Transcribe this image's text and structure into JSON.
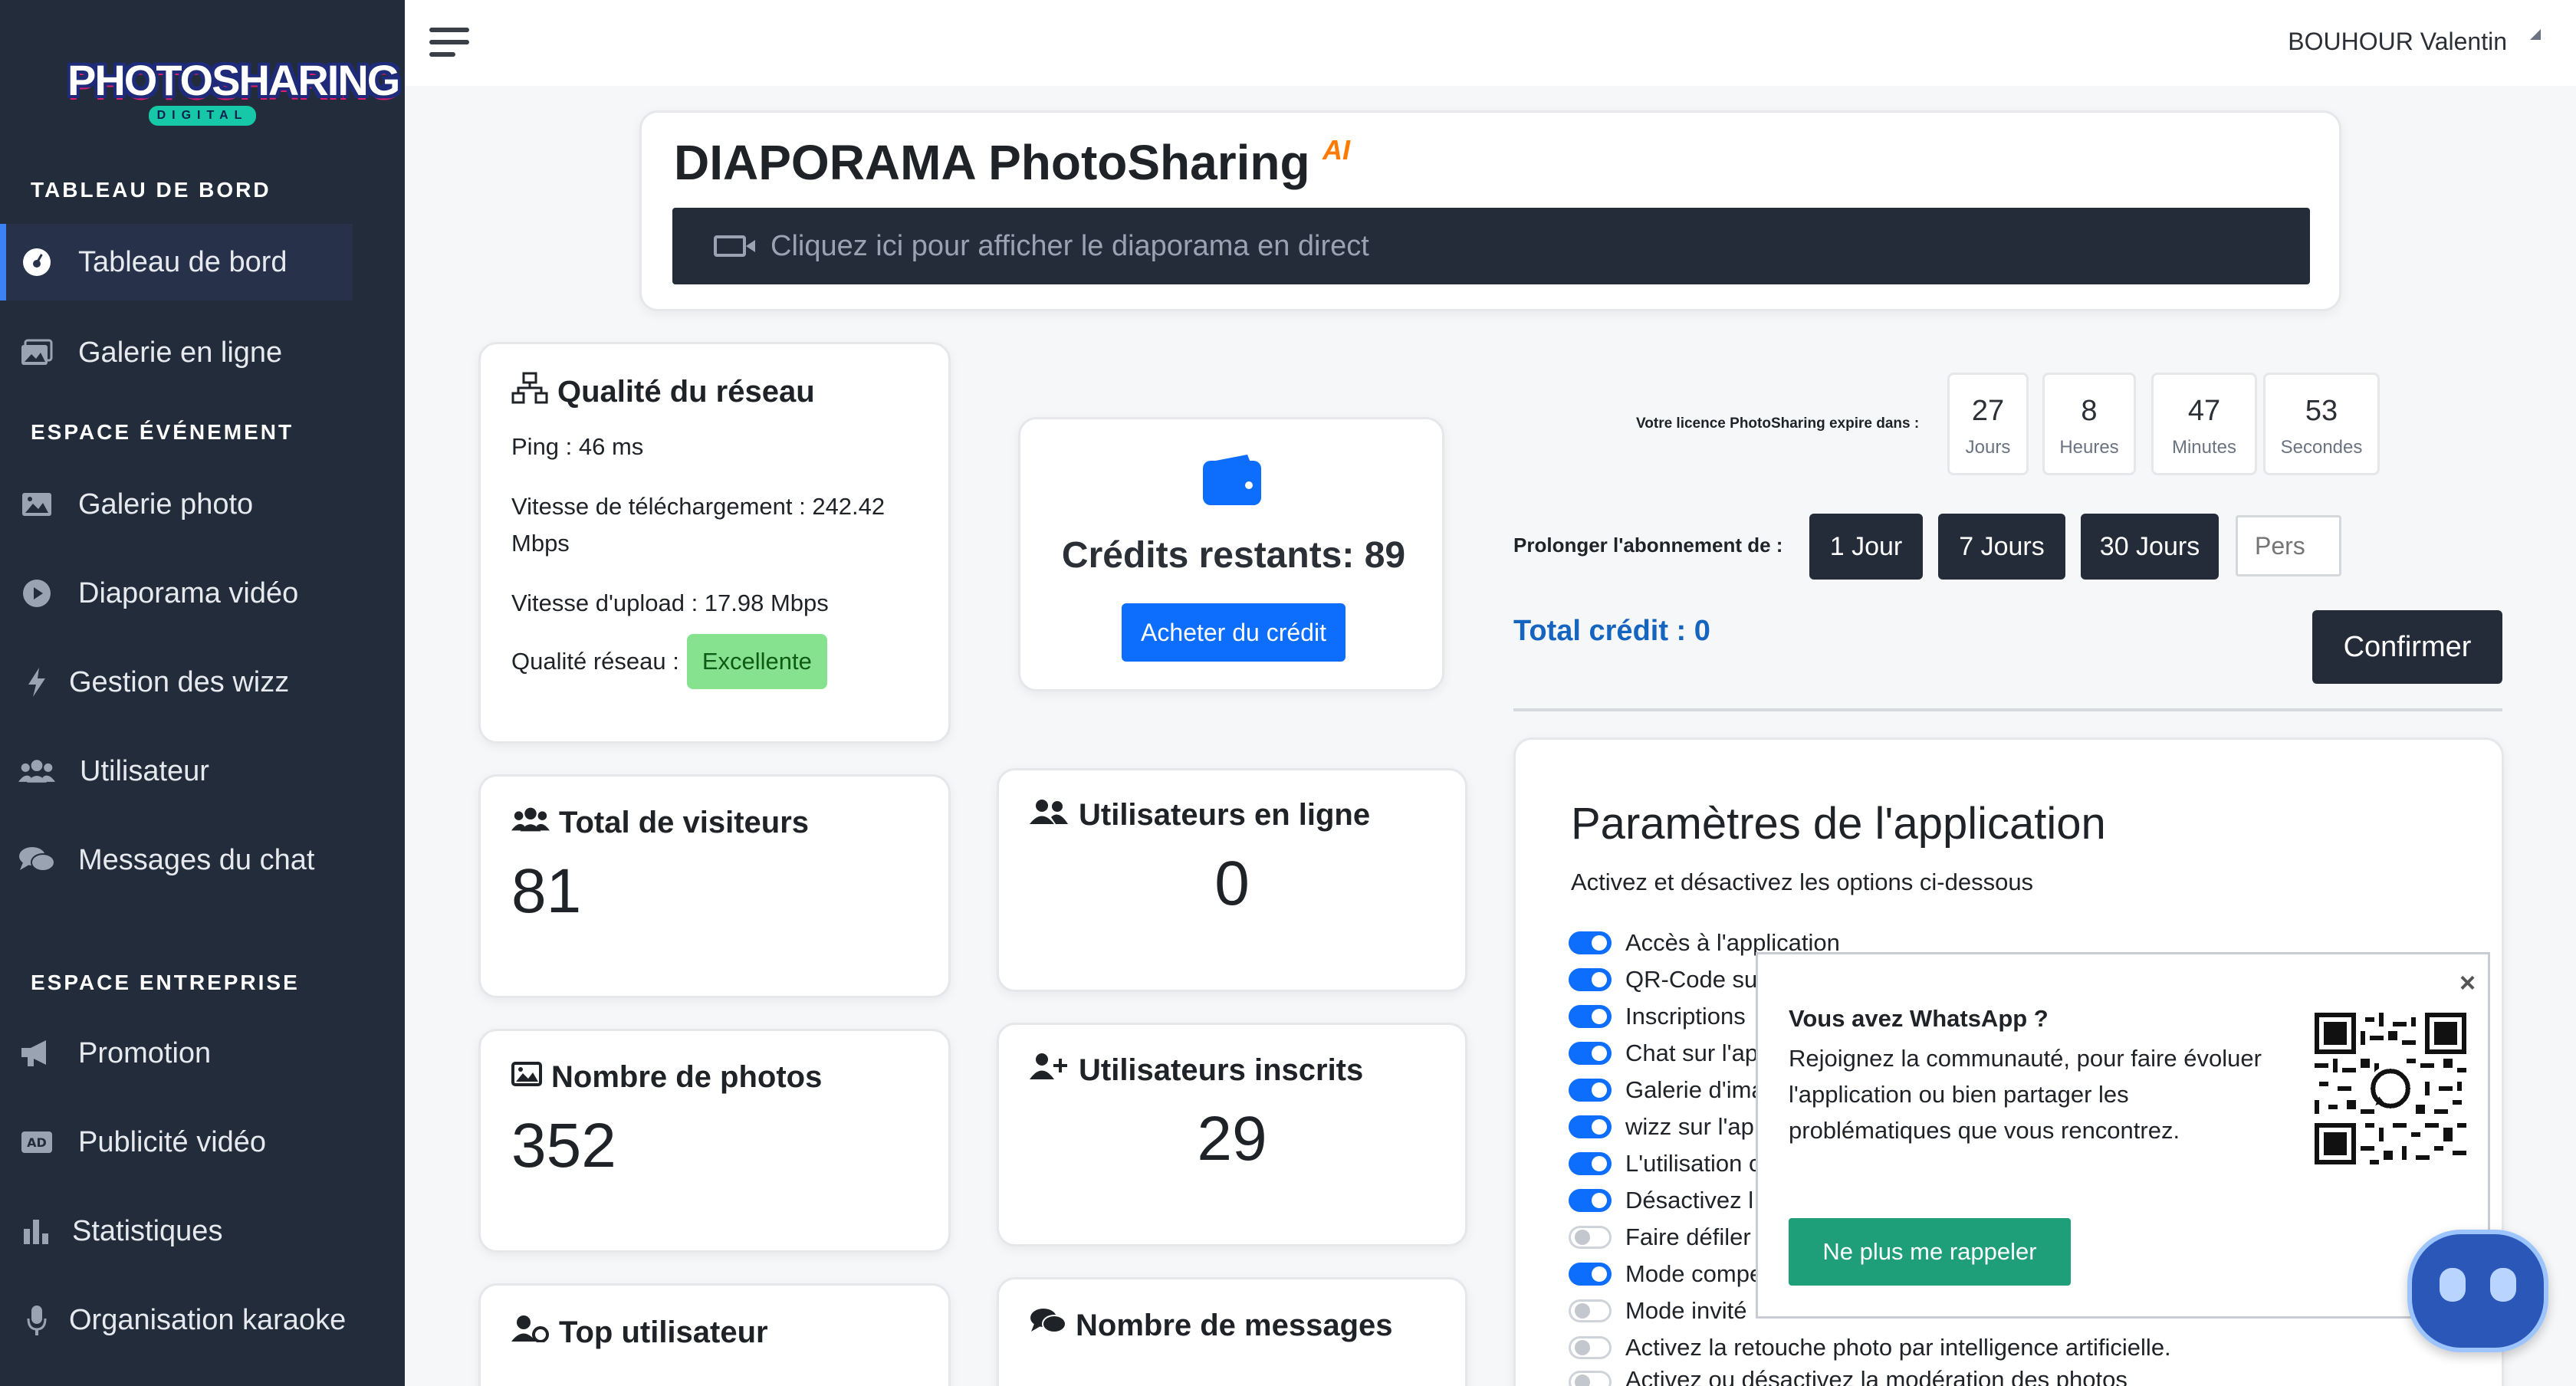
{
  "brand": {
    "name": "PHOTOSHARING",
    "sub": "DIGITAL"
  },
  "sidebar": {
    "sections": [
      {
        "title": "TABLEAU DE BORD"
      },
      {
        "title": "ESPACE ÉVÉNEMENT"
      },
      {
        "title": "ESPACE ENTREPRISE"
      }
    ],
    "items": [
      {
        "label": "Tableau de bord",
        "icon": "dashboard-icon",
        "active": true
      },
      {
        "label": "Galerie en ligne",
        "icon": "images-icon"
      },
      {
        "label": "Galerie photo",
        "icon": "image-icon"
      },
      {
        "label": "Diaporama vidéo",
        "icon": "play-icon"
      },
      {
        "label": "Gestion des wizz",
        "icon": "bolt-icon"
      },
      {
        "label": "Utilisateur",
        "icon": "users-icon"
      },
      {
        "label": "Messages du chat",
        "icon": "comments-icon"
      },
      {
        "label": "Promotion",
        "icon": "megaphone-icon"
      },
      {
        "label": "Publicité vidéo",
        "icon": "ad-icon"
      },
      {
        "label": "Statistiques",
        "icon": "chart-bar-icon"
      },
      {
        "label": "Organisation karaoke",
        "icon": "microphone-icon"
      }
    ]
  },
  "header": {
    "user": "BOUHOUR Valentin"
  },
  "diaporama": {
    "title": "DIAPORAMA PhotoSharing",
    "badge": "AI",
    "bar_text": "Cliquez ici pour afficher le diaporama en direct"
  },
  "network": {
    "title": "Qualité du réseau",
    "ping": "Ping : 46 ms",
    "download_line1": "Vitesse de téléchargement : 242.42",
    "download_line2": "Mbps",
    "upload": "Vitesse d'upload : 17.98 Mbps",
    "quality_label": "Qualité réseau :",
    "quality_value": "Excellente"
  },
  "credits": {
    "title": "Crédits restants: 89",
    "button": "Acheter du crédit"
  },
  "license": {
    "label": "Votre licence PhotoSharing expire dans :",
    "countdown": [
      {
        "value": "27",
        "unit": "Jours"
      },
      {
        "value": "8",
        "unit": "Heures"
      },
      {
        "value": "47",
        "unit": "Minutes"
      },
      {
        "value": "53",
        "unit": "Secondes"
      }
    ]
  },
  "extend": {
    "label": "Prolonger l'abonnement de :",
    "options": [
      "1 Jour",
      "7 Jours",
      "30 Jours"
    ],
    "custom_placeholder": "Pers",
    "total": "Total crédit : 0",
    "confirm": "Confirmer"
  },
  "stats": {
    "visitors": {
      "title": "Total de visiteurs",
      "value": "81"
    },
    "online": {
      "title": "Utilisateurs en ligne",
      "value": "0"
    },
    "photos": {
      "title": "Nombre de photos",
      "value": "352"
    },
    "registered": {
      "title": "Utilisateurs inscrits",
      "value": "29"
    },
    "top_user": {
      "title": "Top utilisateur"
    },
    "messages": {
      "title": "Nombre de messages"
    }
  },
  "settings": {
    "title": "Paramètres de l'application",
    "subtitle": "Activez et désactivez les options ci-dessous",
    "toggles": [
      {
        "label": "Accès à l'application",
        "on": true
      },
      {
        "label": "QR-Code su",
        "on": true
      },
      {
        "label": "Inscriptions",
        "on": true
      },
      {
        "label": "Chat sur l'ap",
        "on": true
      },
      {
        "label": "Galerie d'ima",
        "on": true
      },
      {
        "label": "wizz sur l'ap",
        "on": true
      },
      {
        "label": "L'utilisation c",
        "on": true
      },
      {
        "label": "Désactivez l",
        "on": true
      },
      {
        "label": "Faire défiler",
        "on": false
      },
      {
        "label": "Mode compe",
        "on": true
      },
      {
        "label": "Mode invité",
        "on": false
      },
      {
        "label": "Activez la retouche photo par intelligence artificielle.",
        "on": false
      },
      {
        "label": "Activez ou désactivez la modération des photos",
        "on": false
      }
    ]
  },
  "whatsapp_popup": {
    "title": "Vous avez WhatsApp ?",
    "line1": "Rejoignez la communauté, pour faire évoluer",
    "line2": "l'application ou bien partager les",
    "line3": "problématiques que vous rencontrez.",
    "button": "Ne plus me rappeler",
    "close": "×"
  },
  "colors": {
    "sidebar": "#232c3b",
    "dark_button": "#242c3a",
    "primary": "#0d6efd",
    "success": "#86e28e",
    "total_credit": "#1565c0"
  }
}
